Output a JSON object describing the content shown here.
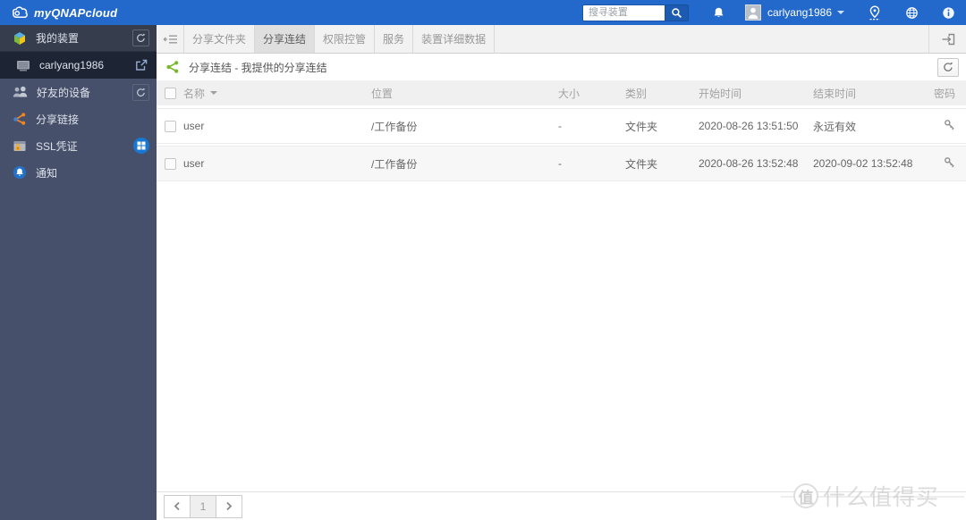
{
  "topbar": {
    "brand": "myQNAPcloud",
    "search_placeholder": "搜寻装置",
    "username": "carlyang1986"
  },
  "sidebar": {
    "items": [
      {
        "label": "我的装置"
      },
      {
        "label": "carlyang1986"
      },
      {
        "label": "好友的设备"
      },
      {
        "label": "分享链接"
      },
      {
        "label": "SSL凭证"
      },
      {
        "label": "通知"
      }
    ]
  },
  "tabs": {
    "items": [
      {
        "label": "分享文件夹"
      },
      {
        "label": "分享连结"
      },
      {
        "label": "权限控管"
      },
      {
        "label": "服务"
      },
      {
        "label": "装置详细数据"
      }
    ],
    "active": "分享连结"
  },
  "page": {
    "title": "分享连结 - 我提供的分享连结"
  },
  "table": {
    "headers": {
      "name": "名称",
      "location": "位置",
      "size": "大小",
      "type": "类别",
      "start": "开始时间",
      "end": "结束时间",
      "password": "密码"
    },
    "rows": [
      {
        "name": "user",
        "location": "/工作备份",
        "size": "-",
        "type": "文件夹",
        "start": "2020-08-26 13:51:50",
        "end": "永远有效"
      },
      {
        "name": "user",
        "location": "/工作备份",
        "size": "-",
        "type": "文件夹",
        "start": "2020-08-26 13:52:48",
        "end": "2020-09-02 13:52:48"
      }
    ]
  },
  "pagination": {
    "page": "1"
  },
  "watermark": {
    "badge": "值",
    "text": "什么值得买"
  },
  "colors": {
    "topbar_blue": "#2368cb",
    "accent_green": "#76b82a",
    "sidebar_slate": "#47506a",
    "sidebar_selected": "#1d2433",
    "badge_blue": "#1877d2"
  }
}
